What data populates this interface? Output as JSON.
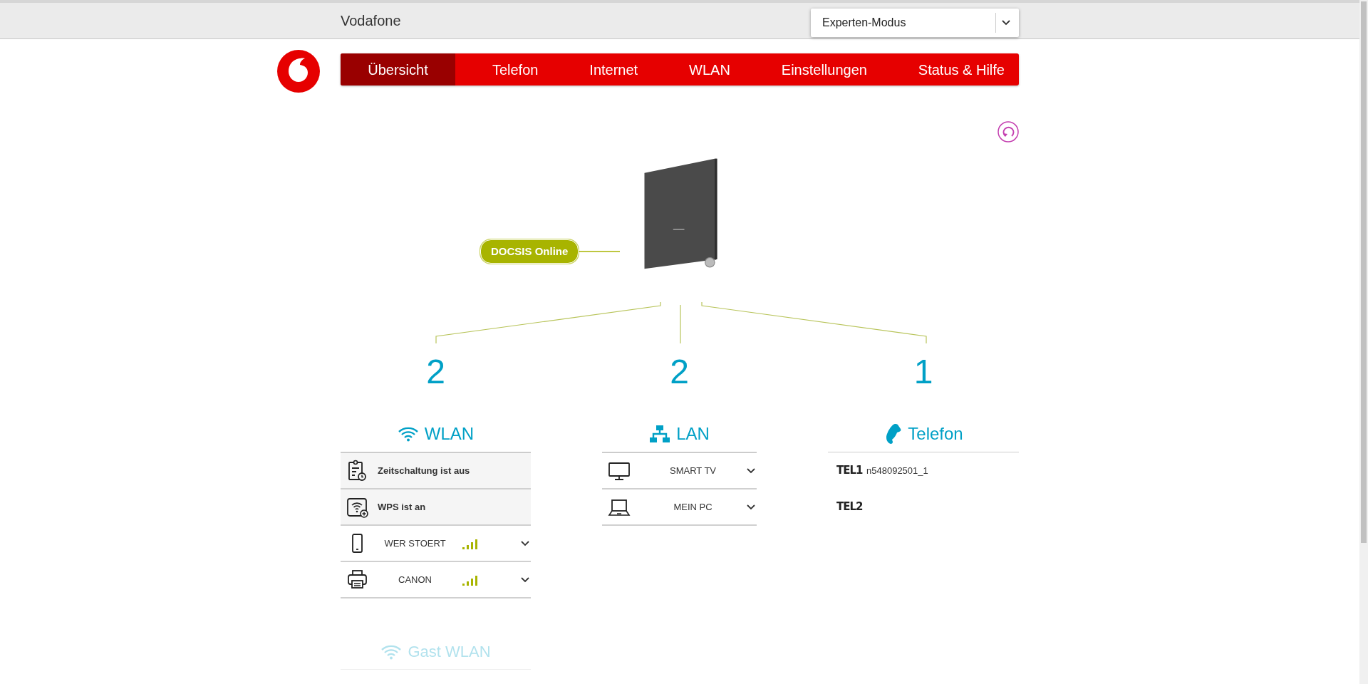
{
  "header": {
    "brand": "Vodafone",
    "mode_select": {
      "value": "Experten-Modus"
    }
  },
  "nav": [
    {
      "label": "Übersicht",
      "selected": true
    },
    {
      "label": "Telefon",
      "selected": false
    },
    {
      "label": "Internet",
      "selected": false
    },
    {
      "label": "WLAN",
      "selected": false
    },
    {
      "label": "Einstellungen",
      "selected": false
    },
    {
      "label": "Status & Hilfe",
      "selected": false
    }
  ],
  "router": {
    "status_badge": "DOCSIS Online"
  },
  "sections": [
    {
      "kind": "wlan",
      "count": "2",
      "title": "WLAN",
      "rows": [
        {
          "kind": "timer",
          "label": "Zeitschaltung ist aus"
        },
        {
          "kind": "wps",
          "label": "WPS ist an"
        },
        {
          "kind": "smartphone",
          "label": "WER STOERT"
        },
        {
          "kind": "printer",
          "label": "CANON"
        }
      ]
    },
    {
      "kind": "lan",
      "count": "2",
      "title": "LAN",
      "rows": [
        {
          "kind": "tv",
          "label": "SMART TV"
        },
        {
          "kind": "laptop",
          "label": "MEIN PC"
        }
      ]
    },
    {
      "kind": "telefon",
      "count": "1",
      "title": "Telefon",
      "rows": [
        {
          "kind": "line",
          "label": "TEL1",
          "number": "n548092501_1"
        },
        {
          "kind": "line",
          "label": "TEL2"
        }
      ]
    }
  ],
  "guest_wlan": {
    "title": "Gast WLAN",
    "disabled": true
  }
}
